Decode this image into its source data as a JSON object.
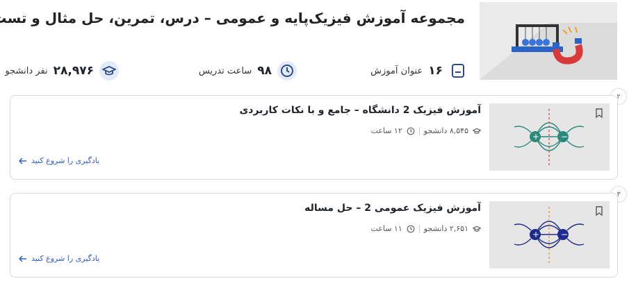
{
  "hero": {
    "title": "مجموعه آموزش فیزیک‌پایه و عمومی – درس، تمرین، حل مثال و تست",
    "stats": [
      {
        "icon": "book-icon",
        "value": "۱۶",
        "label": "عنوان آموزش"
      },
      {
        "icon": "clock-icon",
        "value": "۹۸",
        "label": "ساعت تدریس"
      },
      {
        "icon": "graduation-cap-icon",
        "value": "۲۸,۹۷۶",
        "label": "نفر دانشجو"
      }
    ]
  },
  "courses": [
    {
      "index": "۲",
      "title": "آموزش فیزیک 2 دانشگاه – جامع و با نکات کاربردی",
      "students": "۸,۵۴۵ دانشجو",
      "hours": "۱۲ ساعت",
      "cta": "یادگیری را شروع کنید",
      "thumb_color": "#2a8a7a"
    },
    {
      "index": "۳",
      "title": "آموزش فیزیک عمومی 2 – حل مساله",
      "students": "۲,۶۵۱ دانشجو",
      "hours": "۱۱ ساعت",
      "cta": "یادگیری را شروع کنید",
      "thumb_color": "#1e2a8c"
    }
  ],
  "colors": {
    "accent": "#2e5bd6",
    "icon_bg": "#e3ebfa",
    "border": "#d6d9de"
  }
}
